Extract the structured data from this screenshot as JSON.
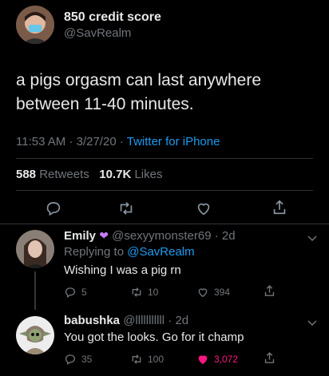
{
  "tweet": {
    "author_name": "850 credit score",
    "author_handle": "@SavRealm",
    "text_line1": "a pigs orgasm can last anywhere",
    "text_line2": "between 11-40 minutes.",
    "time": "11:53 AM",
    "date": "3/27/20",
    "source": "Twitter for iPhone",
    "retweets_count": "588",
    "retweets_label": "Retweets",
    "likes_count": "10.7K",
    "likes_label": "Likes"
  },
  "replies": [
    {
      "name": "Emily",
      "handle": "@sexyymonster69",
      "age": "2d",
      "replying_label": "Replying to",
      "replying_to": "@SavRealm",
      "text": "Wishing I was a pig rn",
      "reply_count": "5",
      "retweet_count": "10",
      "like_count": "394"
    },
    {
      "name": "babushka",
      "handle": "@lllllllllll",
      "age": "2d",
      "text": "You got the looks. Go for it champ",
      "reply_count": "35",
      "retweet_count": "100",
      "like_count": "3,072"
    }
  ],
  "colors": {
    "accent": "#1d9bf0",
    "like": "#f91880",
    "heart_emoji": "#c77dff"
  }
}
